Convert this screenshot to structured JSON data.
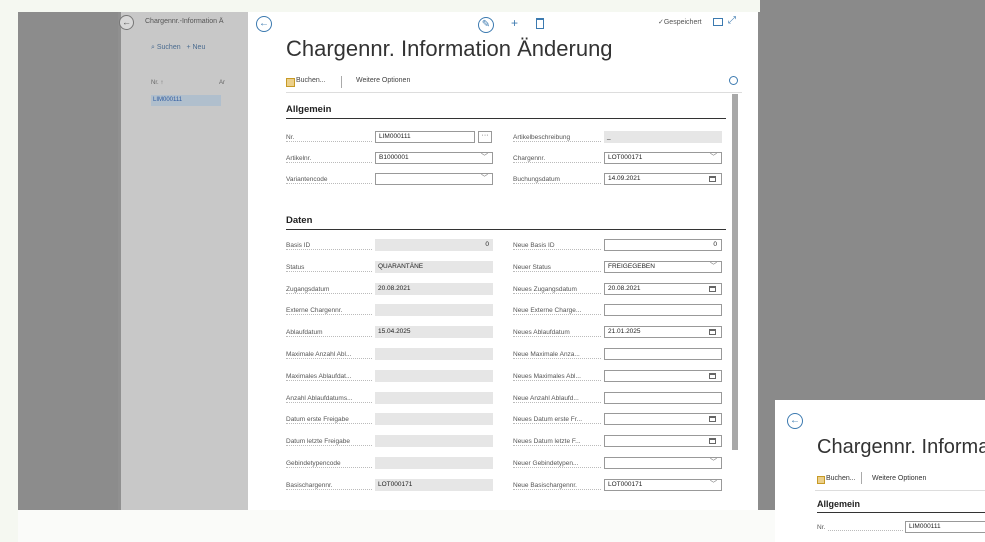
{
  "background_page": {
    "breadcrumb": "Chargennr.-Information Ä",
    "search_label": "Suchen",
    "new_label": "+ Neu",
    "column_header": "Nr. ↑",
    "column_header2": "Ar",
    "selected_row": "LIM000111"
  },
  "dialog": {
    "title": "Chargennr. Information Änderung",
    "saved_label": "✓Gespeichert",
    "toolbar": {
      "post_label": "Buchen...",
      "more_label": "Weitere Optionen"
    },
    "sections": {
      "general": {
        "title": "Allgemein",
        "left": [
          {
            "label": "Nr.",
            "value": "LIM000111"
          },
          {
            "label": "Artikelnr.",
            "value": "B1000001"
          },
          {
            "label": "Variantencode",
            "value": ""
          }
        ],
        "right": [
          {
            "label": "Artikelbeschreibung",
            "value": "_"
          },
          {
            "label": "Chargennr.",
            "value": "LOT000171"
          },
          {
            "label": "Buchungsdatum",
            "value": "14.09.2021"
          }
        ]
      },
      "data": {
        "title": "Daten",
        "left": [
          {
            "label": "Basis ID",
            "value": "0"
          },
          {
            "label": "Status",
            "value": "QUARANTÄNE"
          },
          {
            "label": "Zugangsdatum",
            "value": "20.08.2021"
          },
          {
            "label": "Externe Chargennr.",
            "value": ""
          },
          {
            "label": "Ablaufdatum",
            "value": "15.04.2025"
          },
          {
            "label": "Maximale Anzahl Abl...",
            "value": ""
          },
          {
            "label": "Maximales Ablaufdat...",
            "value": ""
          },
          {
            "label": "Anzahl Ablaufdatums...",
            "value": ""
          },
          {
            "label": "Datum erste Freigabe",
            "value": ""
          },
          {
            "label": "Datum letzte Freigabe",
            "value": ""
          },
          {
            "label": "Gebindetypencode",
            "value": ""
          },
          {
            "label": "Basischargennr.",
            "value": "LOT000171"
          }
        ],
        "right": [
          {
            "label": "Neue Basis ID",
            "value": "0"
          },
          {
            "label": "Neuer Status",
            "value": "FREIGEGEBEN"
          },
          {
            "label": "Neues Zugangsdatum",
            "value": "20.08.2021"
          },
          {
            "label": "Neue Externe Charge...",
            "value": ""
          },
          {
            "label": "Neues Ablaufdatum",
            "value": "21.01.2025"
          },
          {
            "label": "Neue Maximale Anza...",
            "value": ""
          },
          {
            "label": "Neues Maximales Abl...",
            "value": ""
          },
          {
            "label": "Neue Anzahl Ablaufd...",
            "value": ""
          },
          {
            "label": "Neues Datum erste Fr...",
            "value": ""
          },
          {
            "label": "Neues Datum letzte F...",
            "value": ""
          },
          {
            "label": "Neuer Gebindetypen...",
            "value": ""
          },
          {
            "label": "Neue Basischargennr.",
            "value": "LOT000171"
          }
        ]
      }
    }
  },
  "zoom_dialog": {
    "title": "Chargennr. Informa",
    "post_label": "Buchen...",
    "more_label": "Weitere Optionen",
    "section_title": "Allgemein",
    "nr_label": "Nr.",
    "nr_value": "LIM000111"
  }
}
